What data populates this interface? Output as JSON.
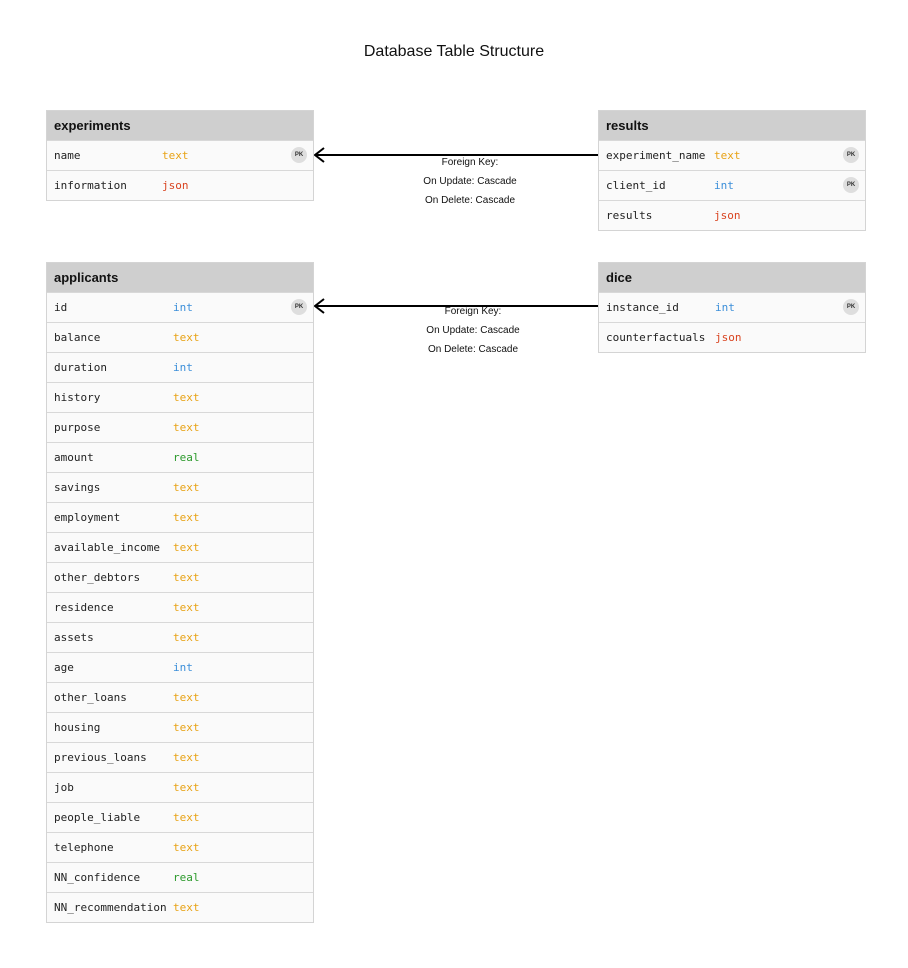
{
  "title": "Database Table Structure",
  "pk_badge": "PK",
  "colors": {
    "text": "#e8a317",
    "int": "#3c8fd9",
    "json": "#d9431f",
    "real": "#2c9a2c"
  },
  "tables": {
    "experiments": {
      "name": "experiments",
      "fields": [
        {
          "name": "name",
          "type": "text",
          "pk": true
        },
        {
          "name": "information",
          "type": "json",
          "pk": false
        }
      ]
    },
    "results": {
      "name": "results",
      "fields": [
        {
          "name": "experiment_name",
          "type": "text",
          "pk": true
        },
        {
          "name": "client_id",
          "type": "int",
          "pk": true
        },
        {
          "name": "results",
          "type": "json",
          "pk": false
        }
      ]
    },
    "applicants": {
      "name": "applicants",
      "fields": [
        {
          "name": "id",
          "type": "int",
          "pk": true
        },
        {
          "name": "balance",
          "type": "text",
          "pk": false
        },
        {
          "name": "duration",
          "type": "int",
          "pk": false
        },
        {
          "name": "history",
          "type": "text",
          "pk": false
        },
        {
          "name": "purpose",
          "type": "text",
          "pk": false
        },
        {
          "name": "amount",
          "type": "real",
          "pk": false
        },
        {
          "name": "savings",
          "type": "text",
          "pk": false
        },
        {
          "name": "employment",
          "type": "text",
          "pk": false
        },
        {
          "name": "available_income",
          "type": "text",
          "pk": false
        },
        {
          "name": "other_debtors",
          "type": "text",
          "pk": false
        },
        {
          "name": "residence",
          "type": "text",
          "pk": false
        },
        {
          "name": "assets",
          "type": "text",
          "pk": false
        },
        {
          "name": "age",
          "type": "int",
          "pk": false
        },
        {
          "name": "other_loans",
          "type": "text",
          "pk": false
        },
        {
          "name": "housing",
          "type": "text",
          "pk": false
        },
        {
          "name": "previous_loans",
          "type": "text",
          "pk": false
        },
        {
          "name": "job",
          "type": "text",
          "pk": false
        },
        {
          "name": "people_liable",
          "type": "text",
          "pk": false
        },
        {
          "name": "telephone",
          "type": "text",
          "pk": false
        },
        {
          "name": "NN_confidence",
          "type": "real",
          "pk": false
        },
        {
          "name": "NN_recommendation",
          "type": "text",
          "pk": false
        }
      ]
    },
    "dice": {
      "name": "dice",
      "fields": [
        {
          "name": "instance_id",
          "type": "int",
          "pk": true
        },
        {
          "name": "counterfactuals",
          "type": "json",
          "pk": false
        }
      ]
    }
  },
  "relations": [
    {
      "from": "results",
      "to": "experiments",
      "label": [
        "Foreign Key:",
        "On Update: Cascade",
        "On Delete: Cascade"
      ]
    },
    {
      "from": "dice",
      "to": "applicants",
      "label": [
        "Foreign Key:",
        "On Update: Cascade",
        "On Delete: Cascade"
      ]
    }
  ]
}
